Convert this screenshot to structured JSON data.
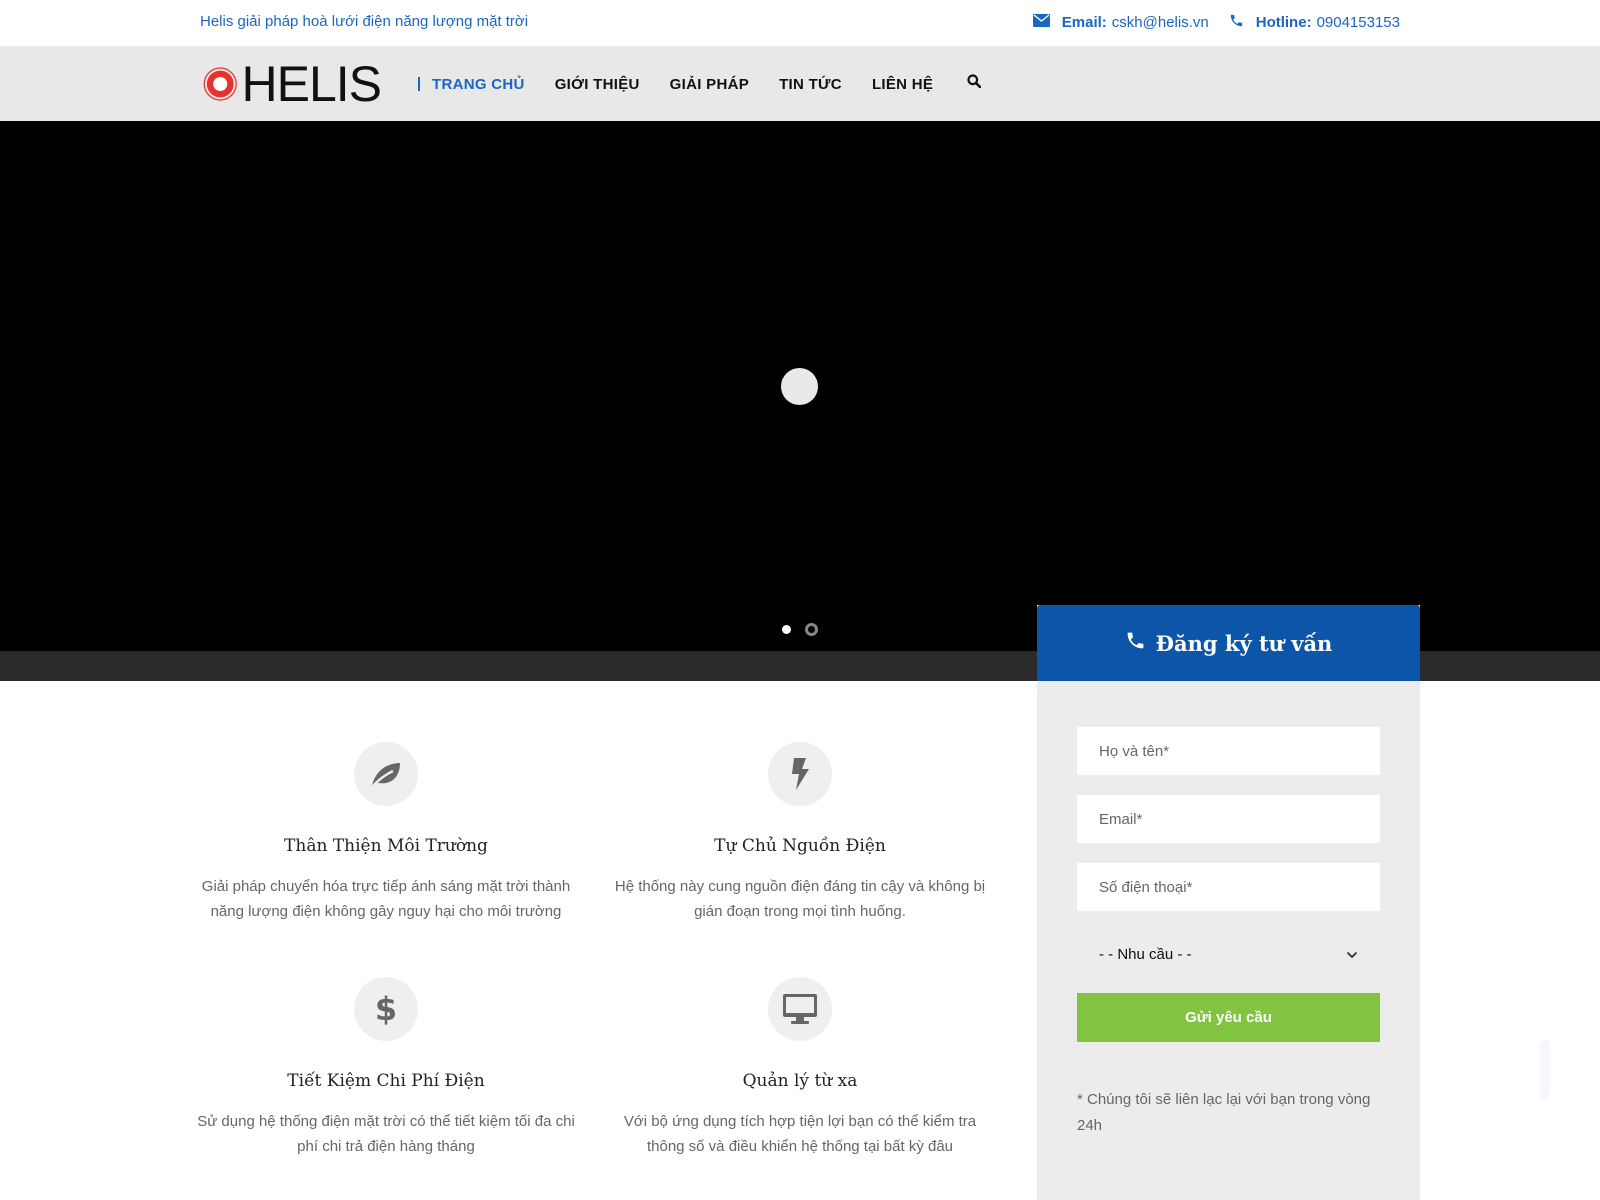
{
  "topbar": {
    "tagline": "Helis giải pháp hoà lưới điện năng lượng mặt trời",
    "email_label": "Email:",
    "email_value": "cskh@helis.vn",
    "hotline_label": "Hotline:",
    "hotline_value": "0904153153"
  },
  "brand": {
    "name": "HELIS",
    "accent": "#1a66c2",
    "logo_red": "#e8322e"
  },
  "nav": {
    "items": [
      {
        "label": "TRANG CHỦ",
        "active": true
      },
      {
        "label": "GIỚI THIỆU"
      },
      {
        "label": "GIẢI PHÁP"
      },
      {
        "label": "TIN TỨC"
      },
      {
        "label": "LIÊN HỆ"
      }
    ],
    "search_icon": "search-icon"
  },
  "slider": {
    "slides": 2,
    "active_index": 0
  },
  "features": [
    {
      "icon": "leaf-icon",
      "title": "Thân Thiện Môi Trường",
      "desc": "Giải pháp chuyển hóa trực tiếp ánh sáng mặt trời thành năng lượng điện không gây nguy hại cho môi trường"
    },
    {
      "icon": "bolt-icon",
      "title": "Tự Chủ Nguồn Điện",
      "desc": "Hệ thống này cung nguồn điện đáng tin cậy và không bị gián đoạn trong mọi tình huống."
    },
    {
      "icon": "dollar-icon",
      "title": "Tiết Kiệm Chi Phí Điện",
      "desc": "Sử dụng hệ thống điện mặt trời có thể tiết kiệm tối đa chi phí chi trả điện hàng tháng"
    },
    {
      "icon": "monitor-icon",
      "title": "Quản lý từ xa",
      "desc": "Với bộ ứng dụng tích hợp tiện lợi bạn có thể kiểm tra thông số và điều khiển hệ thống tại bất kỳ đâu"
    }
  ],
  "form": {
    "title": "Đăng ký tư vấn",
    "name_placeholder": "Họ và tên*",
    "email_placeholder": "Email*",
    "phone_placeholder": "Số điện thoại*",
    "need_selected": "- - Nhu cầu - -",
    "submit_label": "Gửi yêu cầu",
    "note": "* Chúng tôi sẽ liên lạc lại với bạn trong vòng 24h",
    "submit_color": "#82c341",
    "header_color": "#0d55a9"
  }
}
